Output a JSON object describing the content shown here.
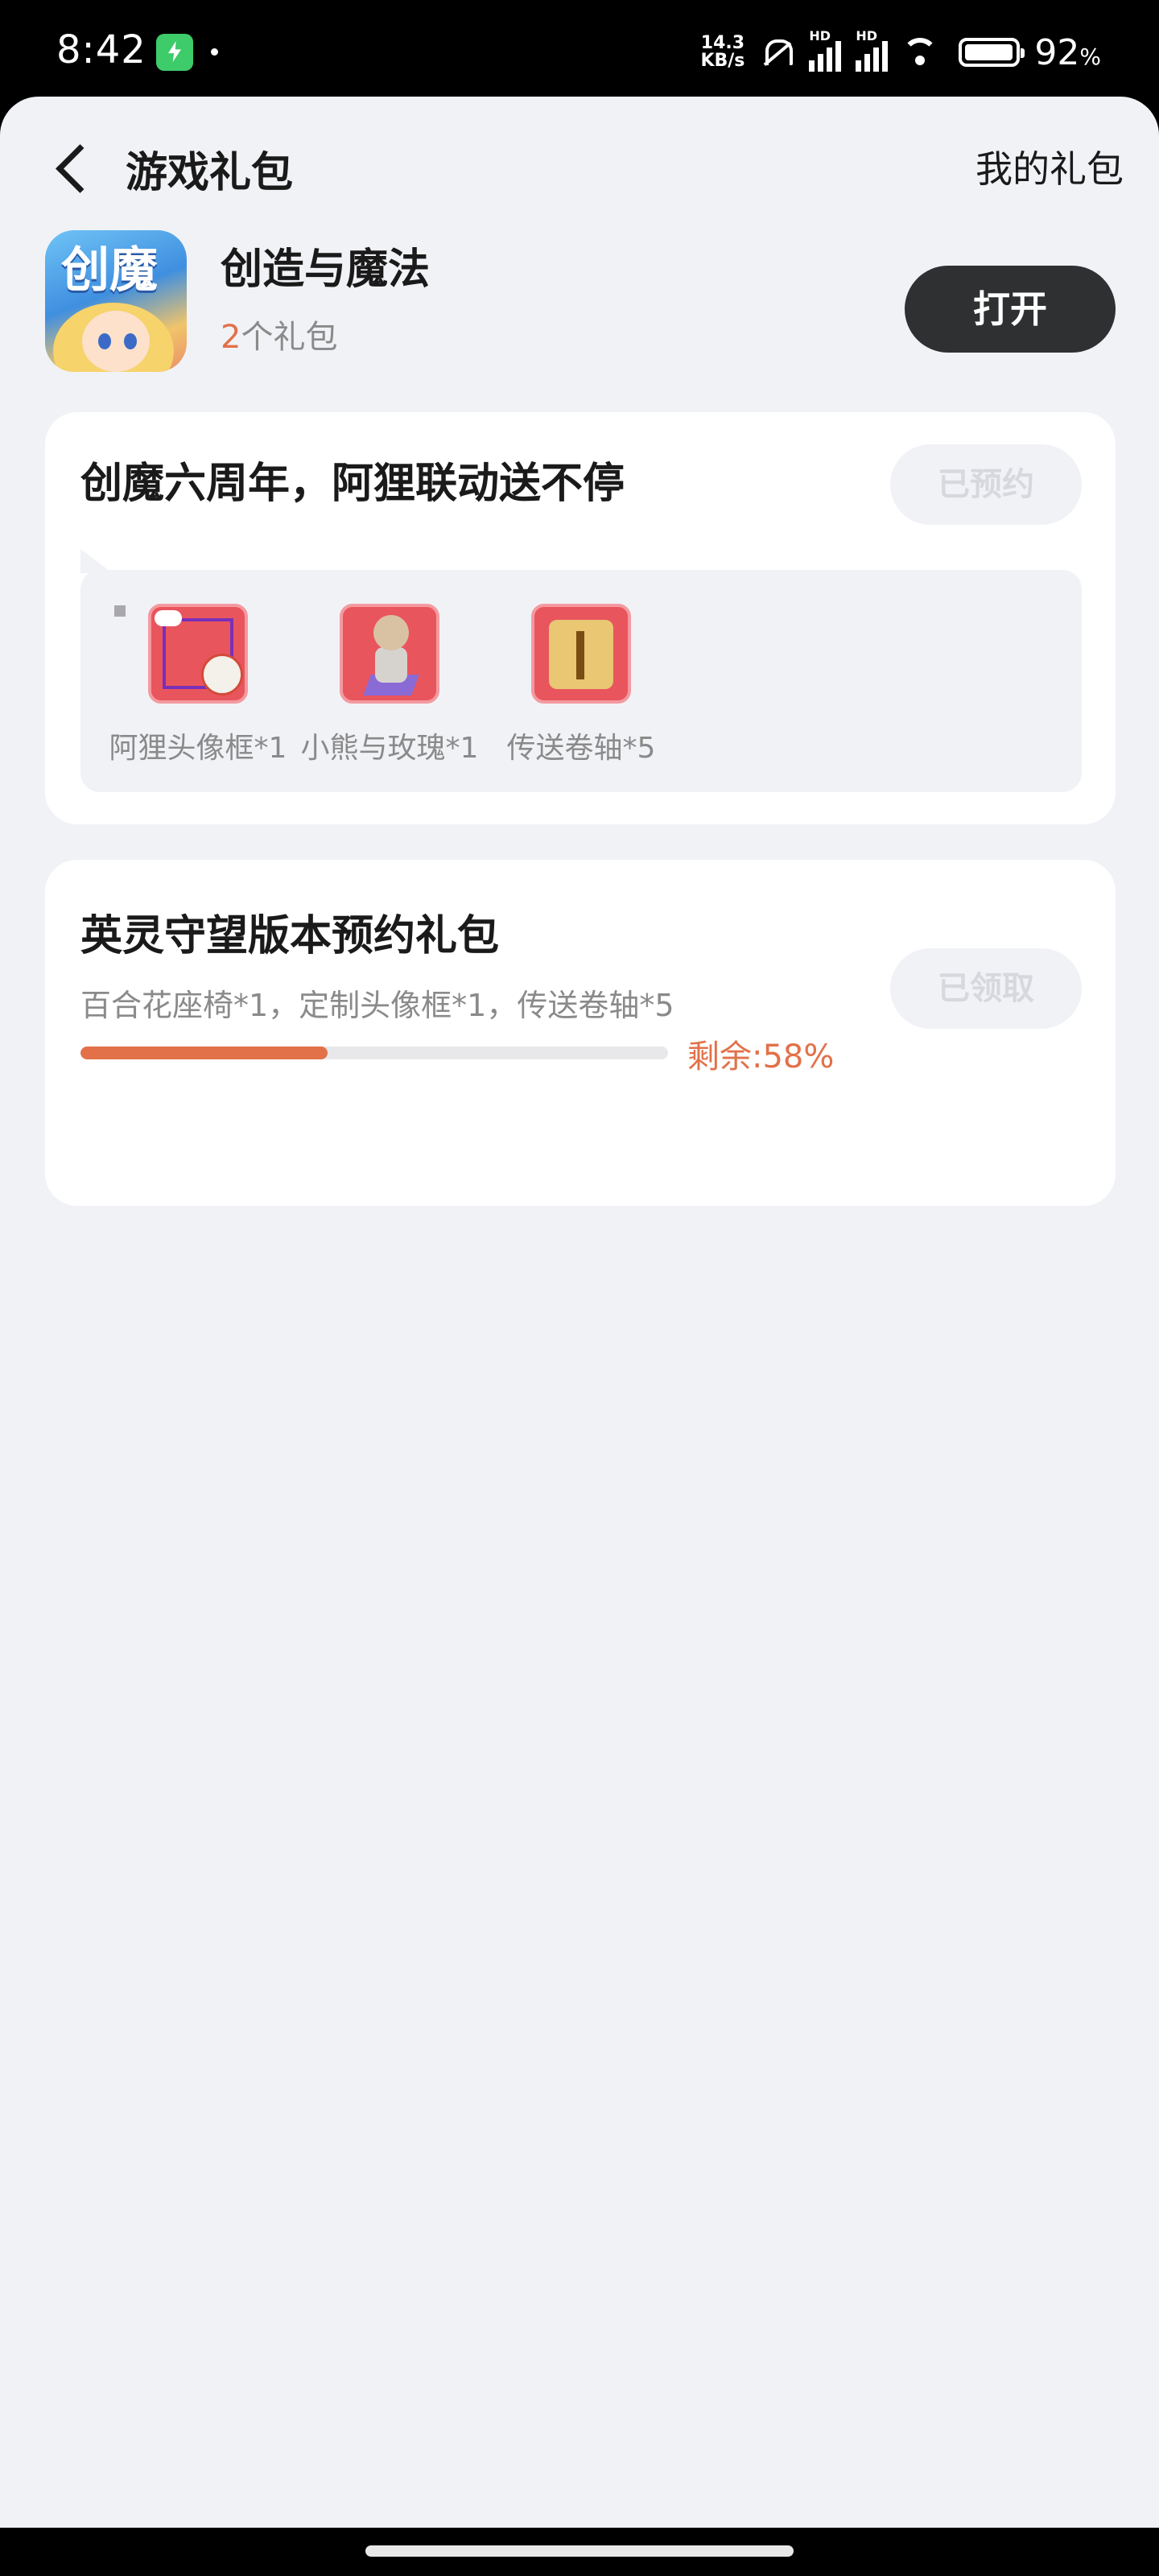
{
  "status_bar": {
    "time": "8:42",
    "net_speed_value": "14.3",
    "net_speed_unit": "KB/s",
    "signal_label_1": "HD",
    "signal_label_2": "HD",
    "battery_percent": "92",
    "battery_unit": "%",
    "icons": [
      "shield-charge-icon",
      "mute-bell-icon",
      "signal-icon",
      "signal-icon",
      "wifi-icon",
      "battery-icon"
    ]
  },
  "header": {
    "title": "游戏礼包",
    "right_link": "我的礼包",
    "back_icon": "chevron-left-icon"
  },
  "game": {
    "name": "创造与魔法",
    "gift_count": "2",
    "gift_count_suffix": "个礼包",
    "open_label": "打开"
  },
  "packs": [
    {
      "title": "创魔六周年，阿狸联动送不停",
      "button_label": "已预约",
      "rewards": [
        {
          "label": "阿狸头像框*1",
          "icon": "avatar-frame-icon"
        },
        {
          "label": "小熊与玫瑰*1",
          "icon": "bear-rose-icon"
        },
        {
          "label": "传送卷轴*5",
          "icon": "teleport-scroll-icon"
        }
      ]
    },
    {
      "title": "英灵守望版本预约礼包",
      "items_text": "百合花座椅*1，定制头像框*1，传送卷轴*5",
      "remaining_label": "剩余:58%",
      "progress_fraction": 0.42,
      "button_label": "已领取"
    }
  ],
  "colors": {
    "accent": "#e2714a",
    "page_bg": "#f1f2f6",
    "open_button": "#2f3031"
  }
}
